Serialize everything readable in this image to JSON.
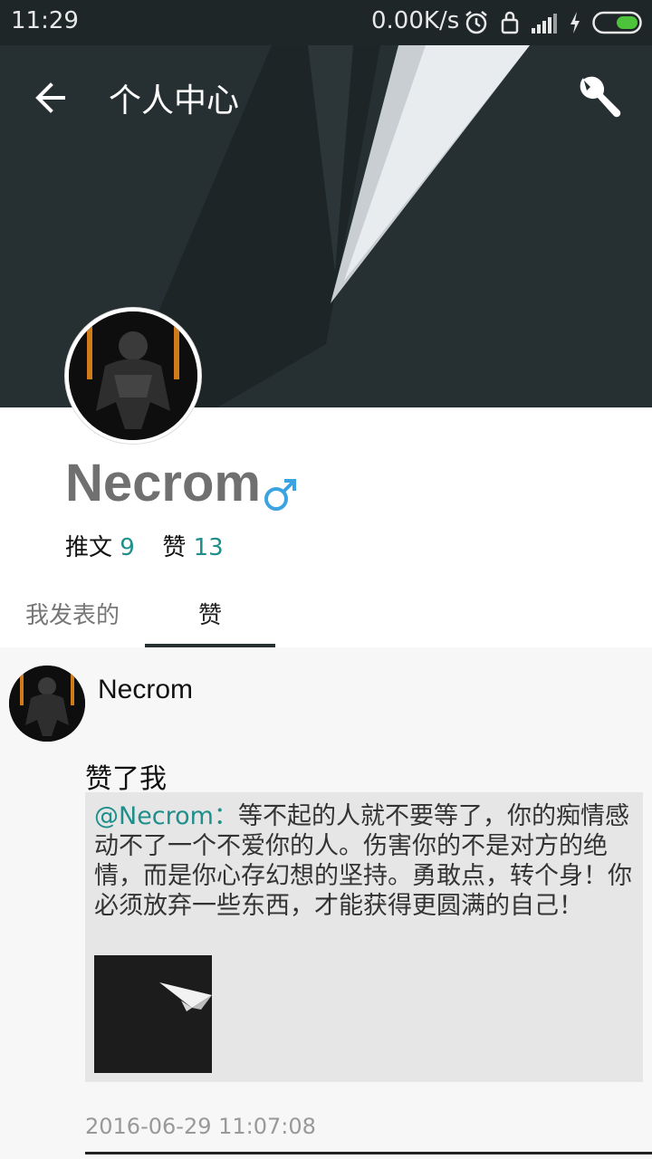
{
  "status_bar": {
    "time": "11:29",
    "network_speed": "0.00K/s",
    "icons": [
      "alarm-icon",
      "lock-icon",
      "signal-icon",
      "charging-icon",
      "battery-icon"
    ]
  },
  "header": {
    "title": "个人中心",
    "back_icon": "arrow-left-icon",
    "settings_icon": "wrench-icon"
  },
  "profile": {
    "username": "Necrom",
    "gender": "male",
    "stats": {
      "posts_label": "推文",
      "posts_count": "9",
      "likes_label": "赞",
      "likes_count": "13"
    }
  },
  "tabs": [
    {
      "label": "我发表的",
      "selected": false
    },
    {
      "label": "赞",
      "selected": true
    }
  ],
  "feed": {
    "items": [
      {
        "author": "Necrom",
        "action": "赞了我",
        "quote_mention": "@Necrom：",
        "quote_text": "等不起的人就不要等了，你的痴情感动不了一个不爱你的人。伤害你的不是对方的绝情，而是你心存幻想的坚持。勇敢点，转个身！你必须放弃一些东西，才能获得更圆满的自己！",
        "time": "2016-06-29 11:07:08"
      }
    ]
  },
  "colors": {
    "header_bg": "#263032",
    "accent": "#1e8f8a",
    "gender_blue": "#3aa3e0"
  }
}
